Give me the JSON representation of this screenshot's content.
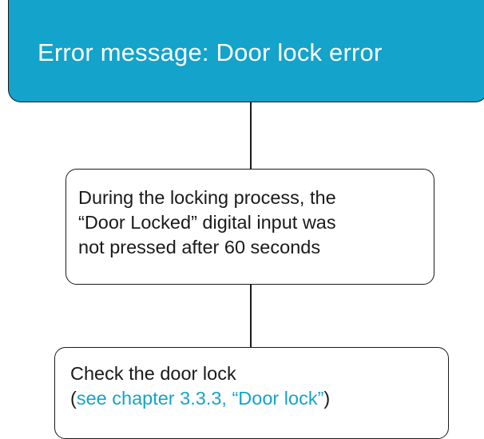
{
  "header": {
    "title": "Error message: Door lock error",
    "fill_color": "#13a3cb",
    "text_color": "#ffffff"
  },
  "cause": {
    "lines": [
      "During the locking process, the",
      "“Door Locked” digital input was",
      "not pressed after 60 seconds"
    ]
  },
  "action": {
    "line1": "Check the door lock",
    "open_paren": "(",
    "link_text": "see chapter 3.3.3, “Door lock”",
    "close_paren": ")",
    "link_color": "#13a3cb"
  }
}
